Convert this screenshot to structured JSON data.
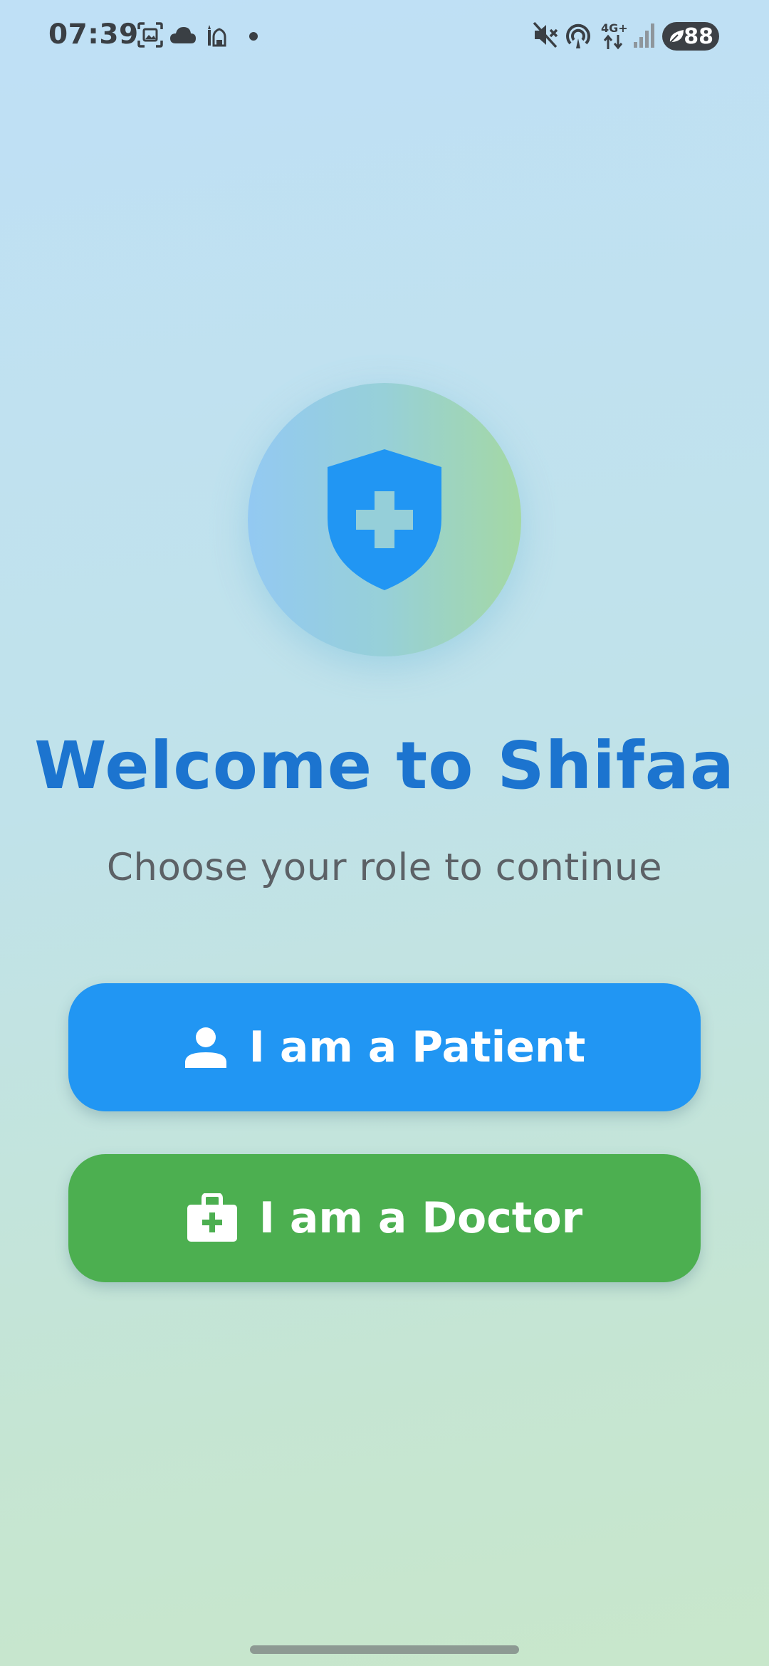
{
  "status_bar": {
    "time": "07:39",
    "battery": "88",
    "network": "4G+",
    "icons": [
      "screenshot-icon",
      "cloud-icon",
      "mosque-icon",
      "dot-icon",
      "mute-icon",
      "hotspot-icon",
      "mobile-data-icon",
      "signal-icon",
      "battery-icon"
    ]
  },
  "welcome": {
    "logo_icon": "shield-medical-icon",
    "title": "Welcome to Shifaa",
    "subtitle": "Choose your role to continue"
  },
  "roles": {
    "patient_label": "I am a Patient",
    "patient_icon": "person-icon",
    "doctor_label": "I am a Doctor",
    "doctor_icon": "medical-bag-icon"
  },
  "colors": {
    "title": "#1c74cf",
    "patient_button": "#2196f3",
    "doctor_button": "#4caf50",
    "shield": "#2196f3"
  }
}
